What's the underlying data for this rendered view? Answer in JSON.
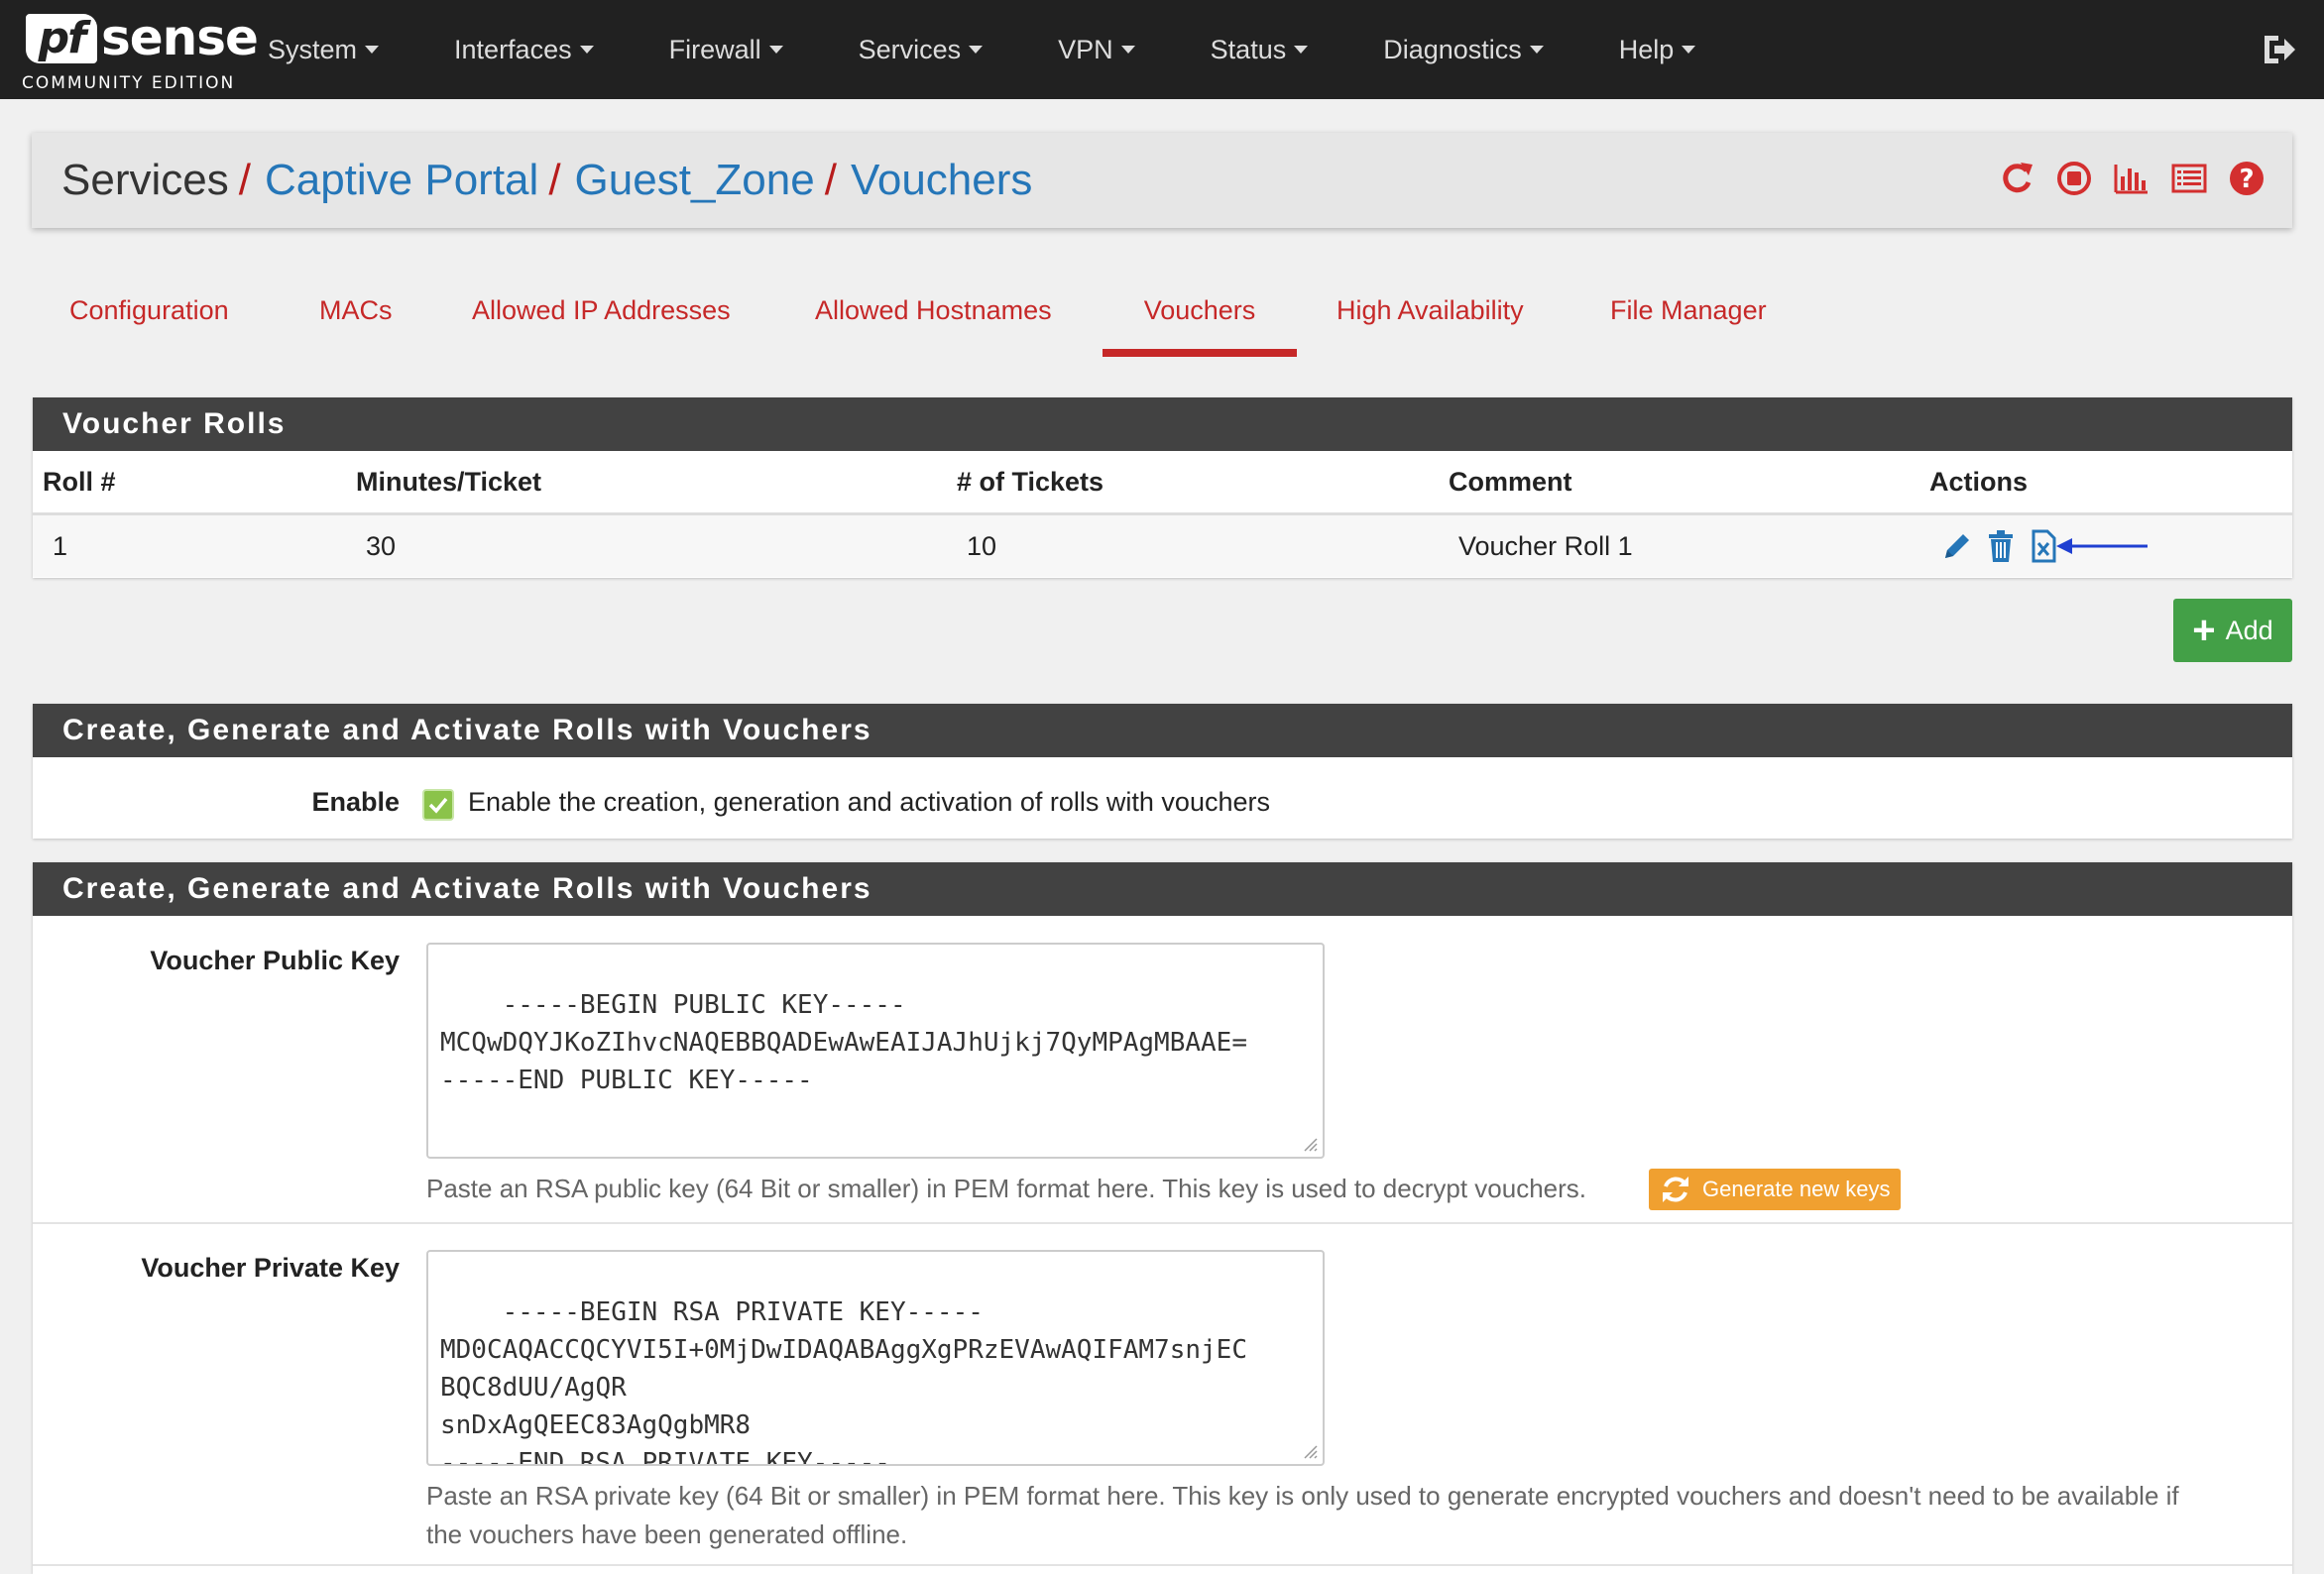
{
  "brand": {
    "name_pf": "pf",
    "name_sense": "sense",
    "edition": "COMMUNITY EDITION"
  },
  "nav": {
    "items": [
      "System",
      "Interfaces",
      "Firewall",
      "Services",
      "VPN",
      "Status",
      "Diagnostics",
      "Help"
    ],
    "logout_icon": "logout-icon"
  },
  "breadcrumb": {
    "first": "Services",
    "links": [
      "Captive Portal",
      "Guest_Zone",
      "Vouchers"
    ],
    "separator": "/",
    "icons": [
      "reload-icon",
      "stop-icon",
      "chart-icon",
      "log-icon",
      "help-icon"
    ]
  },
  "tabs": [
    "Configuration",
    "MACs",
    "Allowed IP Addresses",
    "Allowed Hostnames",
    "Vouchers",
    "High Availability",
    "File Manager"
  ],
  "active_tab": "Vouchers",
  "voucher_rolls": {
    "title": "Voucher Rolls",
    "columns": [
      "Roll #",
      "Minutes/Ticket",
      "# of Tickets",
      "Comment",
      "Actions"
    ],
    "rows": [
      {
        "roll": "1",
        "minutes": "30",
        "tickets": "10",
        "comment": "Voucher Roll 1"
      }
    ],
    "add_label": "Add"
  },
  "enable_panel": {
    "title": "Create, Generate and Activate Rolls with Vouchers",
    "enable_label": "Enable",
    "enable_text": "Enable the creation, generation and activation of rolls with vouchers",
    "enabled": true
  },
  "keys_panel": {
    "title": "Create, Generate and Activate Rolls with Vouchers",
    "public_key_label": "Voucher Public Key",
    "public_key_value": "-----BEGIN PUBLIC KEY-----\nMCQwDQYJKoZIhvcNAQEBBQADEwAwEAIJAJhUjkj7QyMPAgMBAAE=\n-----END PUBLIC KEY-----",
    "public_key_help": "Paste an RSA public key (64 Bit or smaller) in PEM format here. This key is used to decrypt vouchers.",
    "generate_label": "Generate new keys",
    "private_key_label": "Voucher Private Key",
    "private_key_value": "-----BEGIN RSA PRIVATE KEY-----\nMD0CAQACCQCYVI5I+0MjDwIDAQABAggXgPRzEVAwAQIFAM7snjEC\nBQC8dUU/AgQR\nsnDxAgQEEC83AgQgbMR8\n-----END RSA PRIVATE KEY-----",
    "private_key_help_1": "Paste an RSA private key (64 Bit or smaller) in PEM format here. This key is only used to generate encrypted vouchers and doesn't need to be available if",
    "private_key_help_2": "the vouchers have been generated offline."
  },
  "colors": {
    "navbar": "#212121",
    "accent_red": "#c62828",
    "link_blue": "#2576b8",
    "add_green": "#43a047",
    "generate_orange": "#f0a030",
    "panel_head": "#424242"
  }
}
